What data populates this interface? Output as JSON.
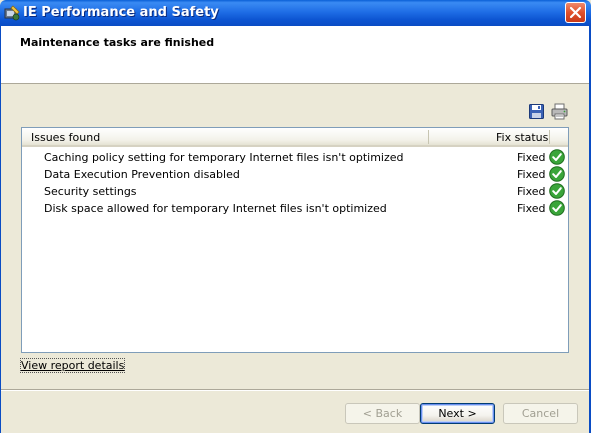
{
  "window": {
    "title": "IE Performance and Safety",
    "app_icon": "ie-maintenance-icon",
    "close_icon": "close-icon"
  },
  "header": {
    "title": "Maintenance tasks are finished"
  },
  "toolbar": {
    "save_icon": "save-icon",
    "print_icon": "print-icon"
  },
  "list": {
    "columns": [
      "Issues found",
      "Fix status"
    ],
    "rows": [
      {
        "issue": "Caching policy setting for temporary Internet files isn't optimized",
        "status": "Fixed",
        "icon": "check-icon"
      },
      {
        "issue": "Data Execution Prevention disabled",
        "status": "Fixed",
        "icon": "check-icon"
      },
      {
        "issue": "Security settings",
        "status": "Fixed",
        "icon": "check-icon"
      },
      {
        "issue": "Disk space allowed for temporary Internet files isn't optimized",
        "status": "Fixed",
        "icon": "check-icon"
      }
    ]
  },
  "links": {
    "report": "View report details"
  },
  "buttons": {
    "back": "< Back",
    "next": "Next >",
    "cancel": "Cancel"
  },
  "colors": {
    "titlebar": "#0a5fd6",
    "fixed_check": "#2f9e2f",
    "close": "#e0512b"
  }
}
